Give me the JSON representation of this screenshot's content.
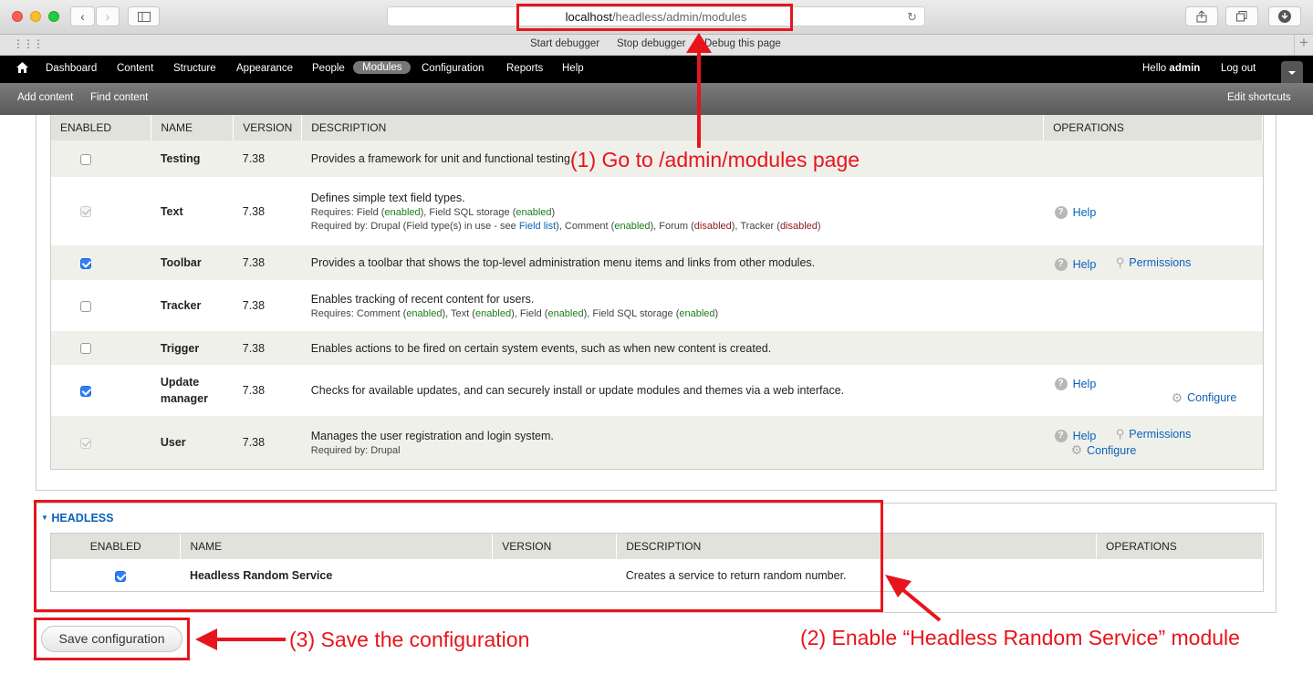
{
  "browser": {
    "url_host": "localhost",
    "url_path": "/headless/admin/modules",
    "back_icon": "chevron-left-icon",
    "forward_icon": "chevron-right-icon",
    "sidebar_icon": "sidebar-icon",
    "reload_icon": "reload-icon",
    "share_icon": "share-icon",
    "tabs_icon": "tabs-icon",
    "download_icon": "download-icon",
    "grid_icon": "grid-icon",
    "plus_icon": "plus-icon",
    "debug_links": [
      "Start debugger",
      "Stop debugger",
      "Debug this page"
    ]
  },
  "toolbar": {
    "home_icon": "home-icon",
    "items": [
      "Dashboard",
      "Content",
      "Structure",
      "Appearance",
      "People",
      "Modules",
      "Configuration",
      "Reports",
      "Help"
    ],
    "active": "Modules",
    "hello": "Hello",
    "user": "admin",
    "logout": "Log out",
    "toggle_icon": "caret-down-icon"
  },
  "shortcuts": {
    "items": [
      "Add content",
      "Find content"
    ],
    "edit": "Edit shortcuts"
  },
  "core_table": {
    "headers": [
      "ENABLED",
      "NAME",
      "VERSION",
      "DESCRIPTION",
      "OPERATIONS"
    ],
    "rows": [
      {
        "name": "Testing",
        "version": "7.38",
        "desc": "Provides a framework for unit and functional testing.",
        "state": "off"
      },
      {
        "name": "Text",
        "version": "7.38",
        "desc": "Defines simple text field types.",
        "state": "disabled-on",
        "req_label": "Requires: Field (",
        "req_en1": "enabled",
        "req_mid": "), Field SQL storage (",
        "req_en2": "enabled",
        "req_end": ")",
        "rb_label": "Required by: Drupal (Field type(s) in use - see ",
        "rb_link": "Field list",
        "rb_mid1": "), Comment (",
        "rb_en": "enabled",
        "rb_mid2": "), Forum (",
        "rb_dis1": "disabled",
        "rb_mid3": "), Tracker (",
        "rb_dis2": "disabled",
        "rb_end": ")",
        "help": "Help"
      },
      {
        "name": "Toolbar",
        "version": "7.38",
        "desc": "Provides a toolbar that shows the top-level administration menu items and links from other modules.",
        "state": "on",
        "help": "Help",
        "permissions": "Permissions"
      },
      {
        "name": "Tracker",
        "version": "7.38",
        "desc": "Enables tracking of recent content for users.",
        "state": "off",
        "req_parts": [
          "Requires: Comment (",
          "enabled",
          "), Text (",
          "enabled",
          "), Field (",
          "enabled",
          "), Field SQL storage (",
          "enabled",
          ")"
        ]
      },
      {
        "name": "Trigger",
        "version": "7.38",
        "desc": "Enables actions to be fired on certain system events, such as when new content is created.",
        "state": "off"
      },
      {
        "name1": "Update",
        "name2": "manager",
        "version": "7.38",
        "desc": "Checks for available updates, and can securely install or update modules and themes via a web interface.",
        "state": "on",
        "help": "Help",
        "configure": "Configure"
      },
      {
        "name": "User",
        "version": "7.38",
        "desc": "Manages the user registration and login system.",
        "state": "disabled-on",
        "req": "Required by: Drupal",
        "help": "Help",
        "permissions": "Permissions",
        "configure": "Configure"
      }
    ]
  },
  "headless": {
    "legend": "HEADLESS",
    "headers": [
      "ENABLED",
      "NAME",
      "VERSION",
      "DESCRIPTION",
      "OPERATIONS"
    ],
    "row": {
      "name": "Headless Random Service",
      "desc": "Creates a service to return random number.",
      "state": "on"
    }
  },
  "save_button": "Save configuration",
  "annotations": {
    "step1": "(1) Go to /admin/modules page",
    "step2": "(2) Enable “Headless Random Service” module",
    "step3": "(3) Save the configuration",
    "color": "#e8141c"
  }
}
